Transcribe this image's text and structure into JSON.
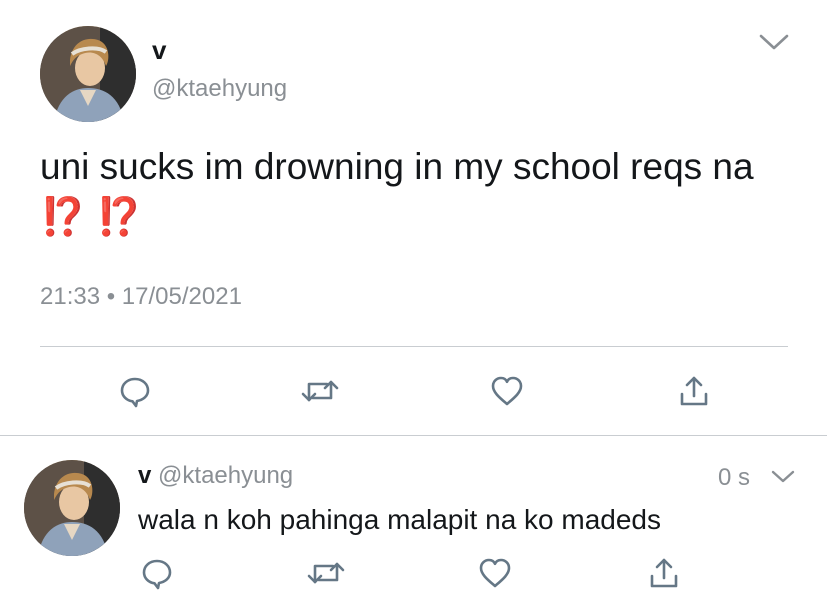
{
  "main_tweet": {
    "display_name": "v",
    "handle": "@ktaehyung",
    "text": "uni sucks im drowning in my school reqs na",
    "emoji": "⁉️ ⁉️",
    "timestamp": "21:33 • 17/05/2021",
    "avatar_alt": "profile photo"
  },
  "reply": {
    "display_name": "v",
    "handle": "@ktaehyung",
    "time_ago": "0 s",
    "text": "wala n koh pahinga malapit na ko madeds"
  },
  "icons": {
    "reply": "comment-icon",
    "retweet": "retweet-icon",
    "like": "heart-icon",
    "share": "share-icon",
    "menu": "chevron-down-icon"
  },
  "colors": {
    "text": "#14171a",
    "muted": "#8a8f94",
    "icon": "#657786",
    "emoji": "#d8432f",
    "divider": "#c9cdd1"
  }
}
